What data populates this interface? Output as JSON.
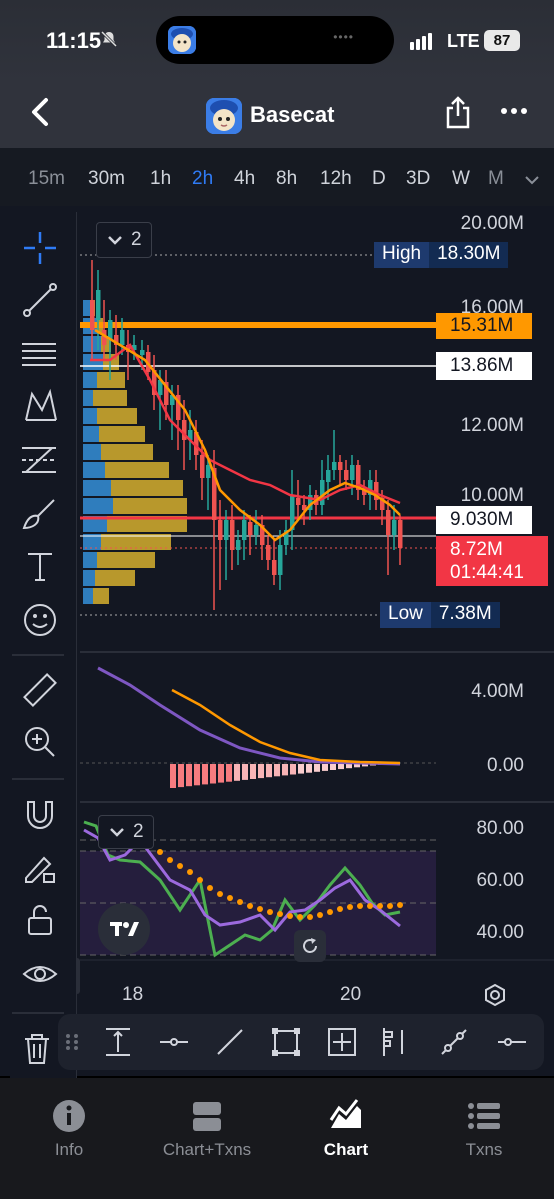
{
  "status_bar": {
    "time": "11:15",
    "network": "LTE",
    "battery": "87"
  },
  "nav": {
    "title": "Basecat"
  },
  "timeframes": [
    {
      "label": "15m",
      "state": "dim"
    },
    {
      "label": "30m",
      "state": "normal"
    },
    {
      "label": "1h",
      "state": "normal"
    },
    {
      "label": "2h",
      "state": "active"
    },
    {
      "label": "4h",
      "state": "normal"
    },
    {
      "label": "8h",
      "state": "normal"
    },
    {
      "label": "12h",
      "state": "normal"
    },
    {
      "label": "D",
      "state": "normal"
    },
    {
      "label": "3D",
      "state": "normal"
    },
    {
      "label": "W",
      "state": "normal"
    },
    {
      "label": "M",
      "state": "dim"
    }
  ],
  "left_tools": [
    "crosshair-icon",
    "trend-line-icon",
    "horizontal-lines-icon",
    "pattern-icon",
    "fib-icon",
    "brush-icon",
    "text-icon",
    "emoji-icon",
    "ruler-icon",
    "zoom-in-icon",
    "magnet-icon",
    "lock-pencil-icon",
    "unlock-icon",
    "eye-icon"
  ],
  "price_pane": {
    "indicator_count": "2",
    "axis_labels": [
      "20.00M",
      "16.00M",
      "12.00M",
      "10.00M"
    ],
    "high": {
      "label": "High",
      "value": "18.30M"
    },
    "line_orange": "15.31M",
    "line_white": "13.86M",
    "line_red": "9.030M",
    "current_price": "8.72M",
    "countdown": "01:44:41",
    "low": {
      "label": "Low",
      "value": "7.38M"
    }
  },
  "macd_pane": {
    "axis_labels": [
      "4.00M",
      "0.00"
    ]
  },
  "rsi_pane": {
    "indicator_count": "2",
    "axis_labels": [
      "80.00",
      "60.00",
      "40.00"
    ]
  },
  "x_axis": [
    "18",
    "20"
  ],
  "tabs": [
    {
      "label": "Info",
      "icon": "info-icon"
    },
    {
      "label": "Chart+Txns",
      "icon": "split-view-icon"
    },
    {
      "label": "Chart",
      "icon": "chart-icon",
      "active": true
    },
    {
      "label": "Txns",
      "icon": "list-icon"
    }
  ],
  "colors": {
    "accent": "#2f7bf5",
    "up": "#26a69a",
    "down": "#ef5350",
    "orange": "#ff9800",
    "purple": "#7e57c2",
    "bg": "#131722"
  }
}
